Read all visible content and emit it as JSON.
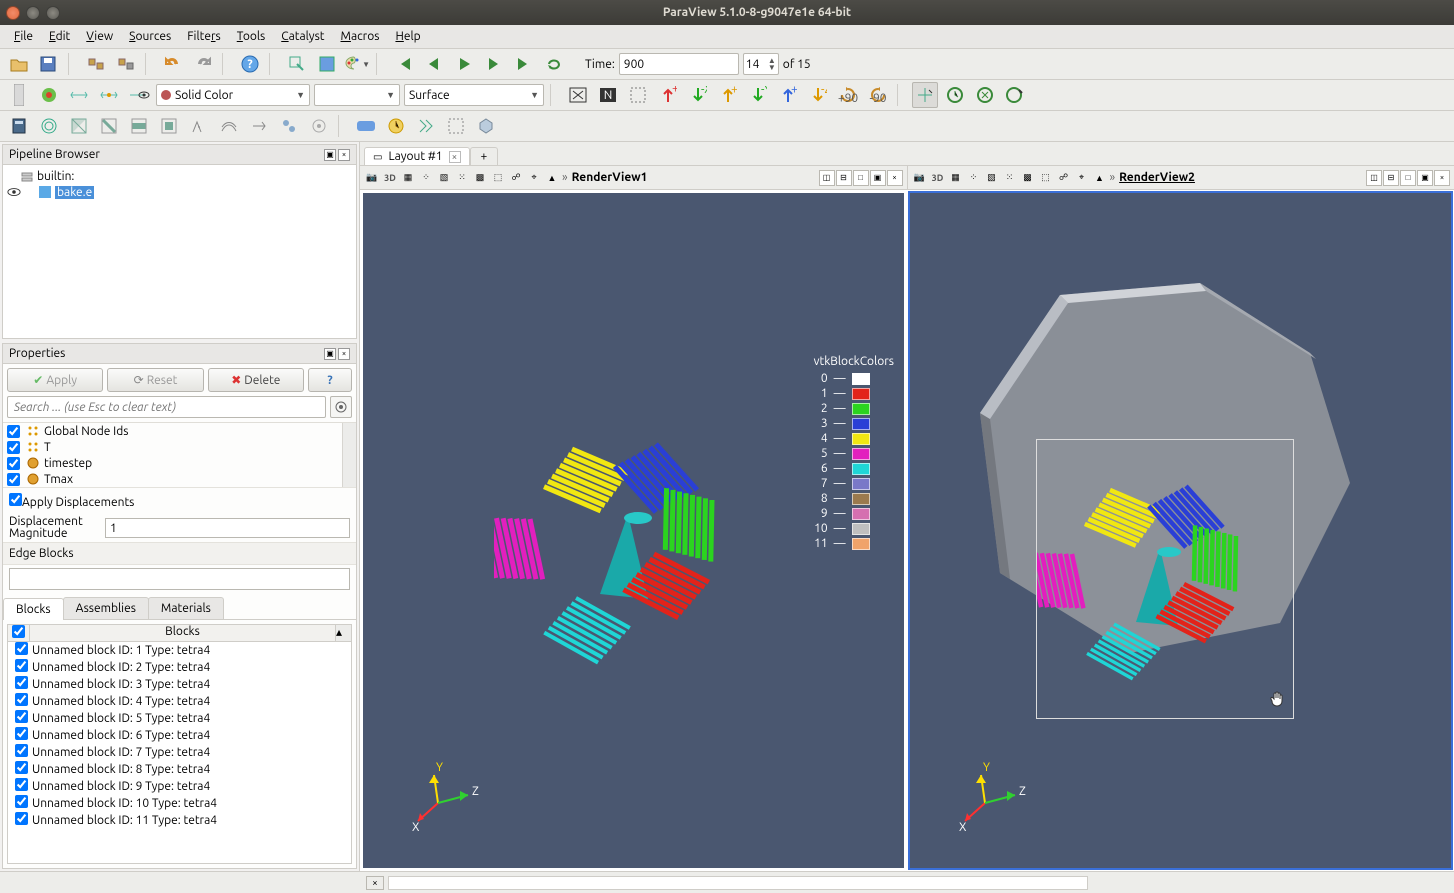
{
  "window": {
    "title": "ParaView 5.1.0-8-g9047e1e 64-bit"
  },
  "menu": {
    "file": "File",
    "edit": "Edit",
    "view": "View",
    "sources": "Sources",
    "filters": "Filters",
    "tools": "Tools",
    "catalyst": "Catalyst",
    "macros": "Macros",
    "help": "Help"
  },
  "toolbar1": {
    "time_label": "Time:",
    "time_value": "900",
    "time_step": "14",
    "time_total": "of 15",
    "coloring": "Solid Color",
    "representation": "Surface"
  },
  "pipeline": {
    "title": "Pipeline Browser",
    "root": "builtin:",
    "item": "bake.e"
  },
  "properties": {
    "title": "Properties",
    "apply": "Apply",
    "reset": "Reset",
    "delete": "Delete",
    "search_placeholder": "Search ... (use Esc to clear text)",
    "vars": [
      "Global Node Ids",
      "T",
      "timestep",
      "Tmax"
    ],
    "apply_disp": "Apply Displacements",
    "disp_label": "Displacement Magnitude",
    "disp_value": "1",
    "edge_blocks": "Edge Blocks",
    "tabs": {
      "blocks": "Blocks",
      "assemblies": "Assemblies",
      "materials": "Materials"
    },
    "blocks_header": "Blocks",
    "blocks": [
      "Unnamed block ID: 1 Type: tetra4",
      "Unnamed block ID: 2 Type: tetra4",
      "Unnamed block ID: 3 Type: tetra4",
      "Unnamed block ID: 4 Type: tetra4",
      "Unnamed block ID: 5 Type: tetra4",
      "Unnamed block ID: 6 Type: tetra4",
      "Unnamed block ID: 7 Type: tetra4",
      "Unnamed block ID: 8 Type: tetra4",
      "Unnamed block ID: 9 Type: tetra4",
      "Unnamed block ID: 10 Type: tetra4",
      "Unnamed block ID: 11 Type: tetra4"
    ]
  },
  "layout": {
    "tab": "Layout #1"
  },
  "views": {
    "v1": "RenderView1",
    "v2": "RenderView2",
    "mode": "3D",
    "legend_title": "vtkBlockColors",
    "legend": [
      {
        "n": "0",
        "c": "#ffffff"
      },
      {
        "n": "1",
        "c": "#e2231a"
      },
      {
        "n": "2",
        "c": "#2bd41f"
      },
      {
        "n": "3",
        "c": "#2a3fd6"
      },
      {
        "n": "4",
        "c": "#f1e712"
      },
      {
        "n": "5",
        "c": "#e21fbe"
      },
      {
        "n": "6",
        "c": "#1fd6d6"
      },
      {
        "n": "7",
        "c": "#7a78c8"
      },
      {
        "n": "8",
        "c": "#9b7a4e"
      },
      {
        "n": "9",
        "c": "#d56fb0"
      },
      {
        "n": "10",
        "c": "#bfbfbf"
      },
      {
        "n": "11",
        "c": "#f0a36a"
      }
    ]
  }
}
